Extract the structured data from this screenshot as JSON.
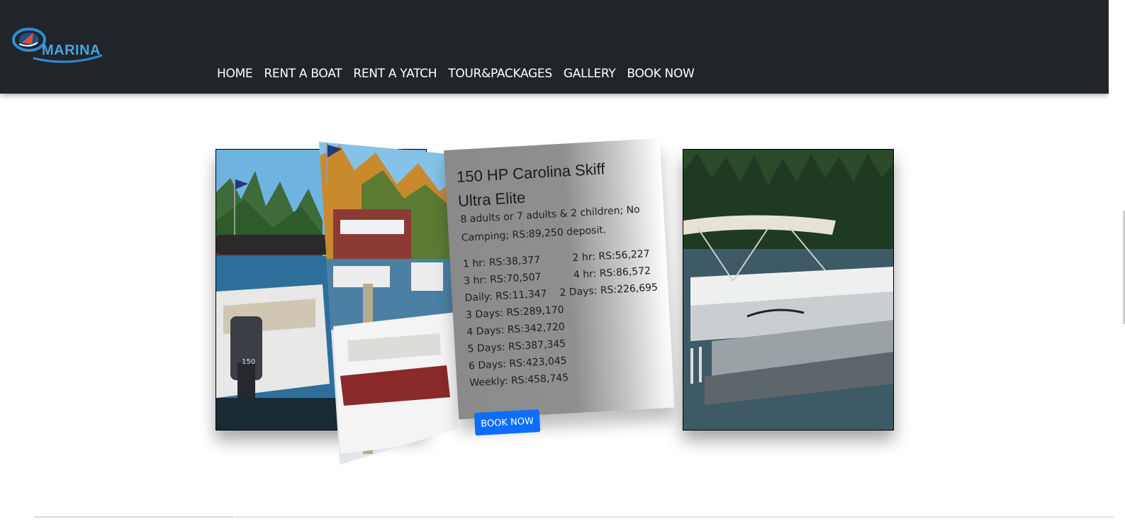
{
  "brand": {
    "logo_text": "MARINA"
  },
  "nav": {
    "items": [
      "HOME",
      "RENT A BOAT",
      "RENT A YATCH",
      "TOUR&PACKAGES",
      "GALLERY",
      "BOOK NOW"
    ]
  },
  "product": {
    "title": "150 HP Carolina Skiff Ultra Elite",
    "description": "8 adults or 7 adults & 2 children; No Camping; RS:89,250 deposit.",
    "prices_left": [
      "1 hr: RS:38,377",
      "3 hr: RS:70,507",
      "Daily: RS:11,347",
      "3 Days: RS:289,170",
      "4 Days: RS:342,720",
      "5 Days: RS:387,345",
      "6 Days: RS:423,045",
      "Weekly: RS:458,745"
    ],
    "prices_right": [
      "2 hr: RS:56,227",
      "4 hr: RS:86,572",
      "2 Days: RS:226,695"
    ],
    "book_label": "BOOK NOW"
  },
  "colors": {
    "header_bg": "#212529",
    "accent_button": "#0d6efd",
    "logo_blue": "#4aa3df"
  }
}
